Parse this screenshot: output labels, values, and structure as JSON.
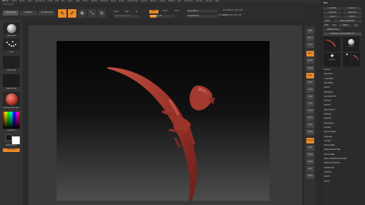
{
  "app": {
    "title": "ZBrush",
    "menu": [
      "Alpha",
      "Brush",
      "Color",
      "Document",
      "Draw",
      "Edit",
      "File",
      "Layer",
      "Light",
      "Macro",
      "Marker",
      "Material",
      "Movie",
      "Picker",
      "Preferences",
      "Render",
      "Stencil",
      "Stroke",
      "Texture",
      "Tool",
      "Transform",
      "Zplugin",
      "Zscript",
      "Help"
    ],
    "subtitle": "ALPHA BRUSH"
  },
  "shelf": {
    "buttons": [
      "Home Page",
      "LightBox",
      "Live Boolean"
    ],
    "modes": [
      {
        "label": "Edit",
        "icon": "✎",
        "on": true
      },
      {
        "label": "Draw",
        "icon": "✐",
        "on": true
      },
      {
        "label": "Move",
        "icon": "✥",
        "on": false
      },
      {
        "label": "Scale",
        "icon": "⤡",
        "on": false
      },
      {
        "label": "Rotate",
        "icon": "↻",
        "on": false
      }
    ],
    "mrgb": "Mrgb",
    "rgb": "Rgb",
    "m": "M",
    "zadd": "Zadd",
    "zsub": "Zsub",
    "zcut": "Zcut",
    "rgb_intensity": "Rgb Intensity 100",
    "z_intensity": "Z Intensity 25",
    "focal_shift": "Focal Shift 0",
    "draw_size": "Draw Size 64",
    "active_points": "ActivePoints: 481,125",
    "total_points": "TotalPoints: 481,125",
    "dynamic": "Dynamic",
    "accent": "#e98a28",
    "rgb_intensity_level": 1.0,
    "z_intensity_level": 0.25
  },
  "left_tray": {
    "brush_label": "Standard",
    "stroke_label": "Dots",
    "alpha_label": "Alpha Off",
    "texture_label": "Texture Off",
    "material_label": "MatCap Red Wax",
    "gradient_label": "Gradient",
    "switch_label": "SwitchColor",
    "alternate_label": "Alternate"
  },
  "right_tray": [
    "BPR",
    "SPix 3",
    "Scroll",
    "Zoom",
    "Actual",
    "AAHalf",
    "Persp",
    "Floor",
    "Local",
    "L.Sym",
    "XYZ",
    "Frame",
    "Move",
    "Scale",
    "Rotate",
    "Line Fill",
    "PolyF",
    "Transp",
    "Ghost",
    "Solo",
    "Xpose"
  ],
  "tool_panel": {
    "title": "Tool",
    "rows": [
      [
        "Load Tool",
        "Save As"
      ],
      [
        "Copy Tool",
        "Paste Tool"
      ],
      [
        "Import",
        "Export"
      ],
      [
        "Clone",
        "Make PolyMesh3D"
      ],
      [
        "GoZ",
        "All",
        "Visible",
        "R"
      ],
      [
        "Lightbox▸Tools"
      ]
    ],
    "current_tool": "ZS_Demon_Chinese_Blade: 48",
    "thumbs": [
      "ZS_Demon_Chinese_Blade",
      "Cylinder3D",
      "SimpleBrush",
      "PolyMesh3D",
      "ZS_Demon_Chin"
    ],
    "sections": [
      "Subtool",
      "Geometry",
      "ArrayMesh",
      "NanoMesh",
      "Layers",
      "FiberMesh",
      "Geometry HD",
      "Preview",
      "Surface",
      "Deformation",
      "Masking",
      "Visibility",
      "Polygroups",
      "Contact",
      "Morph Target",
      "Polypaint",
      "UV Map",
      "Texture Map",
      "Displacement Map",
      "Normal Map",
      "Vector Displacement Map",
      "Display Properties",
      "Unified Skin",
      "Initialize",
      "Import",
      "Export"
    ]
  }
}
